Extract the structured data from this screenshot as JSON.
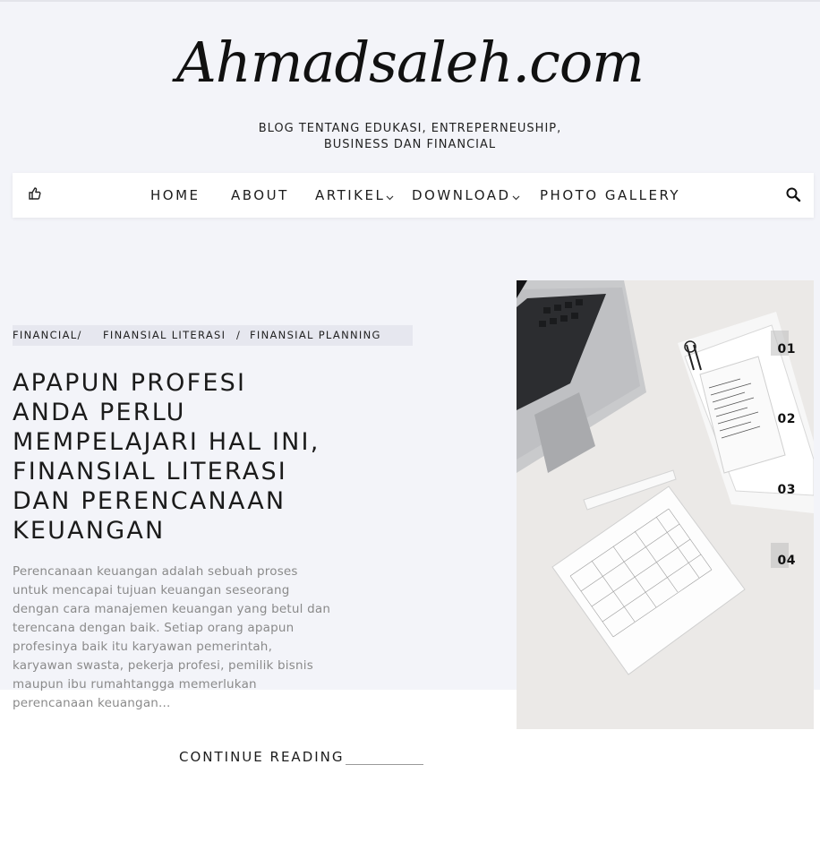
{
  "site": {
    "logo": "Ahmadsaleh.com",
    "tagline_line1": "BLOG TENTANG EDUKASI, ENTREPERNEUSHIP,",
    "tagline_line2": "BUSINESS DAN FINANCIAL"
  },
  "nav": {
    "items": [
      {
        "label": "HOME"
      },
      {
        "label": "ABOUT"
      },
      {
        "label": "ARTIKEL",
        "has_dropdown": true
      },
      {
        "label": "DOWNLOAD",
        "has_dropdown": true
      },
      {
        "label": "PHOTO GALLERY"
      }
    ],
    "left_icon": "thumbs-up-icon",
    "right_icon": "search-icon"
  },
  "post": {
    "categories": [
      "FINANCIAL/",
      "FINANSIAL LITERASI",
      "/",
      "FINANSIAL PLANNING"
    ],
    "title_lines": [
      "APAPUN PROFESI",
      "ANDA PERLU",
      "MEMPELAJARI HAL INI,",
      "FINANSIAL LITERASI",
      "DAN PERENCANAAN",
      "KEUANGAN"
    ],
    "excerpt_lines": [
      "Perencanaan keuangan adalah sebuah proses",
      "untuk mencapai tujuan keuangan seseorang",
      "dengan cara manajemen keuangan yang betul dan",
      "terencana dengan baik. Setiap orang apapun",
      "profesinya baik itu karyawan pemerintah,",
      "karyawan swasta, pekerja profesi, pemilik bisnis",
      "maupun ibu rumahtangga memerlukan",
      "perencanaan keuangan..."
    ],
    "continue_label": "CONTINUE READING"
  },
  "slider": {
    "numbers": [
      "01",
      "02",
      "03",
      "04"
    ]
  },
  "colors": {
    "hero_background": "#f3f4f9",
    "text_dark": "#1d1d1d",
    "excerpt_gray": "#8a8a8a",
    "category_bar": "#e6e7ef"
  }
}
